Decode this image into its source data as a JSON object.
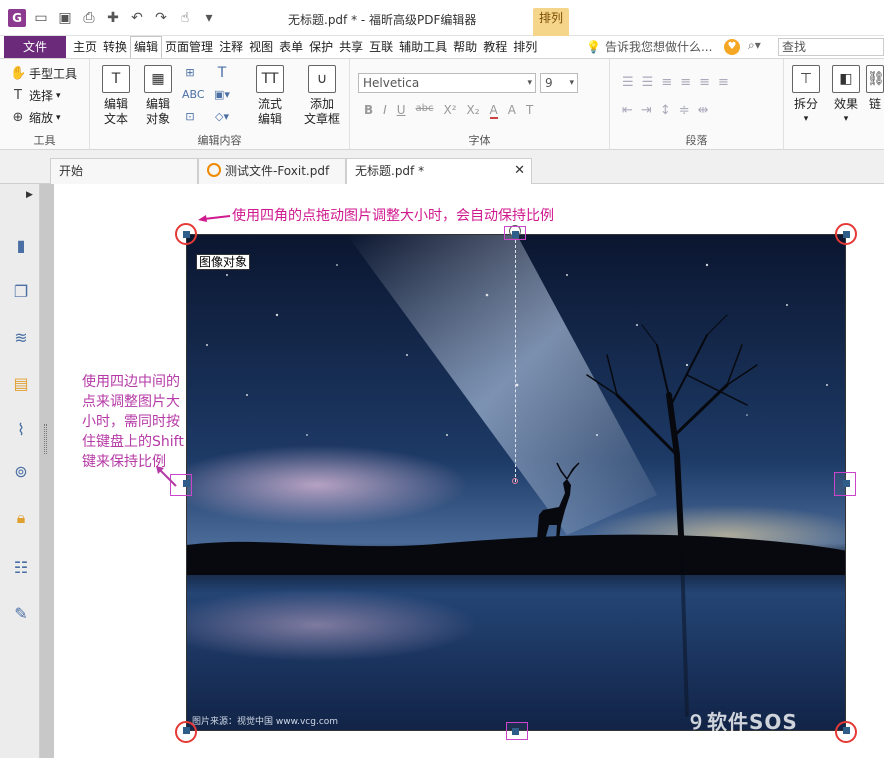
{
  "window": {
    "title": "无标题.pdf * - 福昕高级PDF编辑器",
    "context_tab": "排列"
  },
  "menu": {
    "file": "文件",
    "items": [
      "主页",
      "转换",
      "编辑",
      "页面管理",
      "注释",
      "视图",
      "表单",
      "保护",
      "共享",
      "互联",
      "辅助工具",
      "帮助",
      "教程",
      "排列"
    ],
    "active": "编辑",
    "tell_me": "告诉我您想做什么...",
    "search_placeholder": "查找"
  },
  "ribbon": {
    "tools": {
      "hand": "手型工具",
      "select": "选择",
      "zoom": "缩放",
      "label": "工具"
    },
    "edit": {
      "edit_text": "编辑\n文本",
      "edit_object": "编辑\n对象",
      "flow_edit": "流式\n编辑",
      "add_textbox": "添加\n文章框",
      "label": "编辑内容"
    },
    "font": {
      "family": "Helvetica",
      "size": "9",
      "label": "字体",
      "styles": [
        "B",
        "I",
        "U",
        "abc",
        "X²",
        "X₂",
        "A",
        "A",
        "T"
      ]
    },
    "paragraph": {
      "label": "段落"
    },
    "split": "拆分",
    "effect": "效果",
    "link": "链"
  },
  "tabs": [
    {
      "label": "开始",
      "active": false
    },
    {
      "label": "测试文件-Foxit.pdf",
      "active": false
    },
    {
      "label": "无标题.pdf *",
      "active": true
    }
  ],
  "document": {
    "object_label": "图像对象",
    "credit": "图片来源：视觉中国 www.vcg.com",
    "annotation_corner": "使用四角的点拖动图片调整大小时，会自动保持比例",
    "annotation_edge": "使用四边中间的点来调整图片大小时，需同时按住键盘上的Shift键来保持比例"
  },
  "watermark": "软件SOS",
  "colors": {
    "file_tab": "#6b2b7a",
    "context_tab": "#f4d58a",
    "annotation": "#d0188f",
    "ring": "#e53935",
    "handle": "#2f5d8a"
  }
}
